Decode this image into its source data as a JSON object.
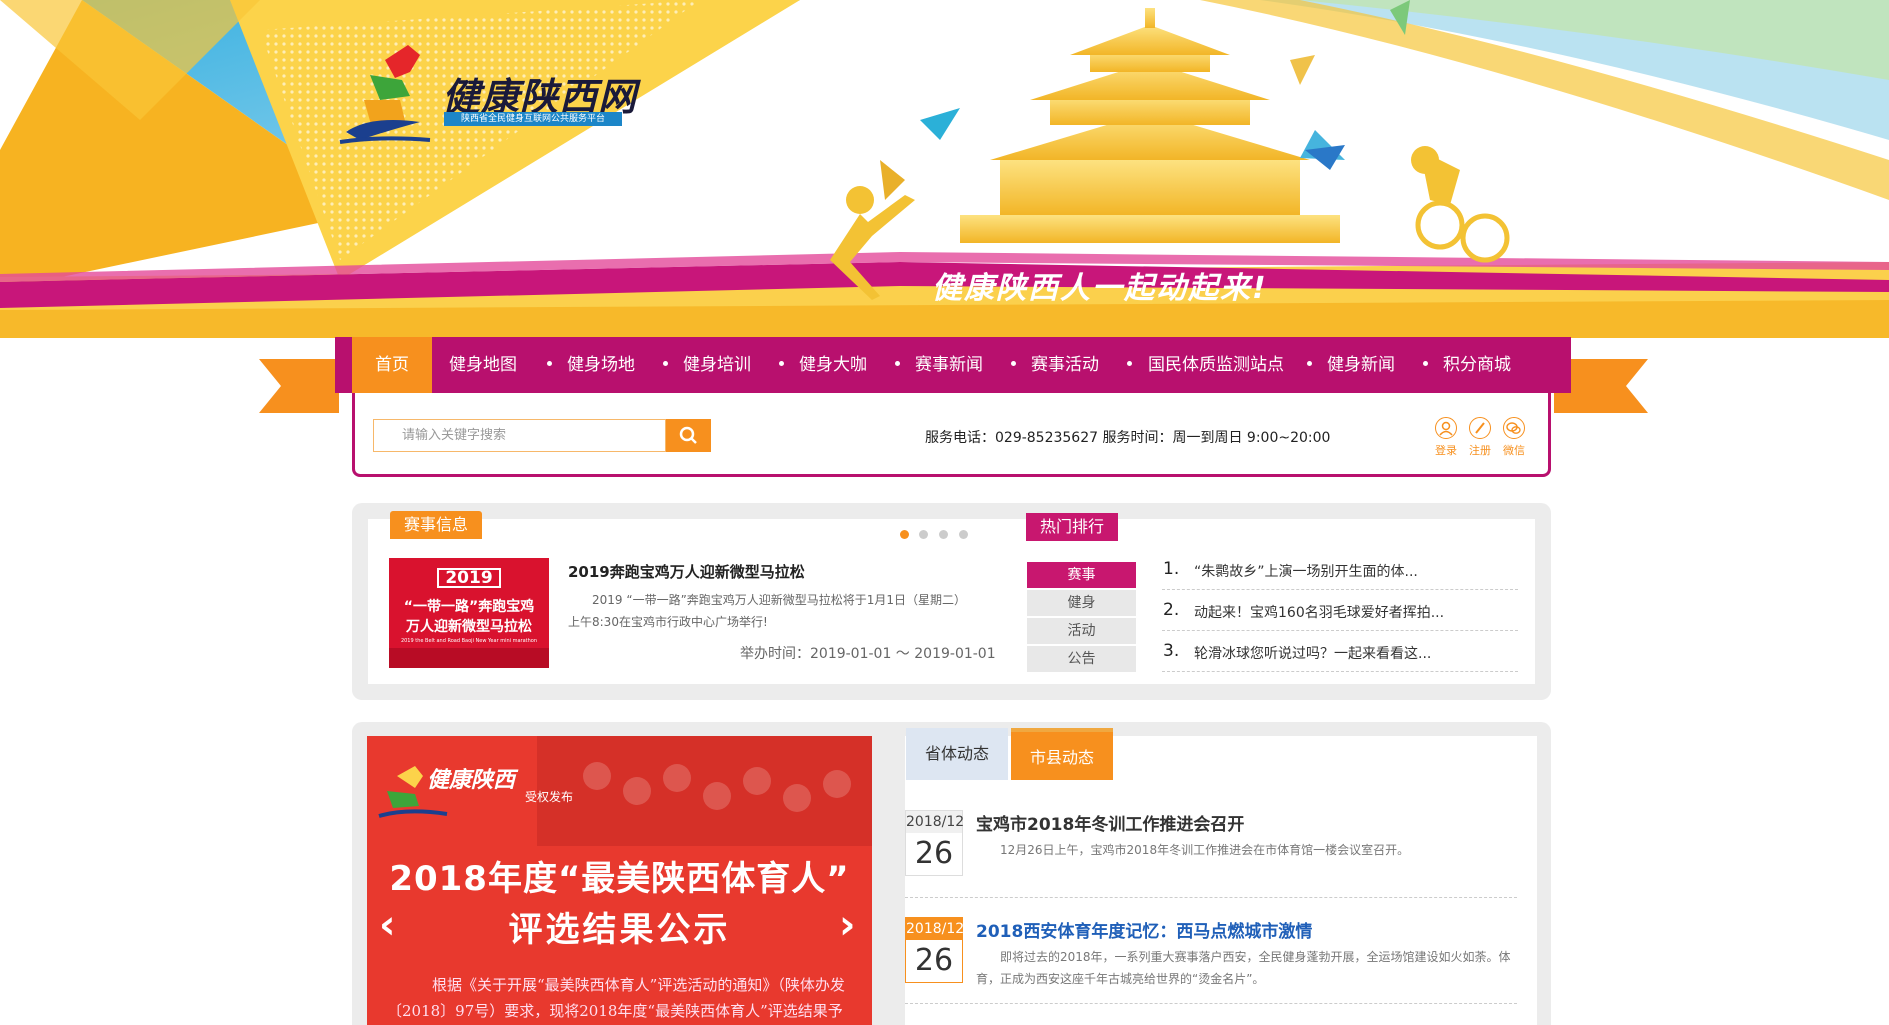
{
  "banner": {
    "logo_title": "健康陕西网",
    "logo_sub": "陕西省全民健身互联网公共服务平台",
    "slogan": "健康陕西人一起动起来!"
  },
  "nav": {
    "items": [
      "首页",
      "健身地图",
      "健身场地",
      "健身培训",
      "健身大咖",
      "赛事新闻",
      "赛事活动",
      "国民体质监测站点",
      "健身新闻",
      "积分商城"
    ],
    "active_index": 0
  },
  "search": {
    "placeholder": "请输入关键字搜索",
    "service_text": "服务电话：029-85235627 服务时间：周一到周日 9:00~20:00"
  },
  "user_actions": [
    "登录",
    "注册",
    "微信"
  ],
  "events": {
    "tag": "赛事信息",
    "image_year": "2019",
    "image_line1": "“一带一路”奔跑宝鸡",
    "image_line2": "万人迎新微型马拉松",
    "image_en": "2019 the Belt and Road Baoji New Year mini marathon",
    "title": "2019奔跑宝鸡万人迎新微型马拉松",
    "desc": "2019 “一带一路”奔跑宝鸡万人迎新微型马拉松将于1月1日（星期二）上午8:30在宝鸡市行政中心广场举行!",
    "time": "举办时间：2019-01-01 ～ 2019-01-01",
    "carousel_active": 0
  },
  "ranking": {
    "tag": "热门排行",
    "tabs": [
      "赛事",
      "健身",
      "活动",
      "公告"
    ],
    "active_tab": 0,
    "items": [
      {
        "num": "1.",
        "text": "“朱鹮故乡”上演一场别开生面的体..."
      },
      {
        "num": "2.",
        "text": "动起来！宝鸡160名羽毛球爱好者挥拍..."
      },
      {
        "num": "3.",
        "text": "轮滑冰球您听说过吗？一起来看看这..."
      }
    ]
  },
  "slide": {
    "logo": "健康陕西",
    "badge": "受权发布",
    "line1": "2018年度“最美陕西体育人”",
    "line2": "评选结果公示",
    "para": "根据《关于开展“最美陕西体育人”评选活动的通知》（陕体办发〔2018〕97号）要求，现将2018年度“最美陕西体育人”评选结果予以公示。"
  },
  "news": {
    "tabs": [
      "省体动态",
      "市县动态"
    ],
    "active_tab": 1,
    "items": [
      {
        "ym": "2018/12",
        "day": "26",
        "title": "宝鸡市2018年冬训工作推进会召开",
        "desc": "12月26日上午，宝鸡市2018年冬训工作推进会在市体育馆一楼会议室召开。"
      },
      {
        "ym": "2018/12",
        "day": "26",
        "title": "2018西安体育年度记忆：西马点燃城市激情",
        "desc": "即将过去的2018年，一系列重大赛事落户西安，全民健身蓬勃开展，全运场馆建设如火如荼。体育，正成为西安这座千年古城亮给世界的“烫金名片”。"
      }
    ]
  },
  "colors": {
    "accent": "#f7901e",
    "brand": "#b8106e",
    "link": "#1f5fb8"
  }
}
